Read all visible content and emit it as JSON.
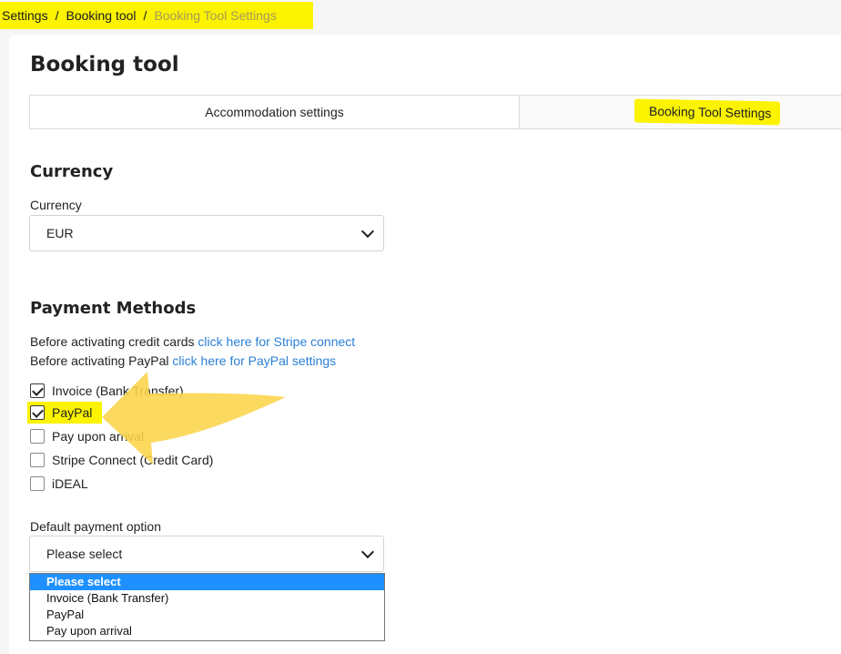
{
  "breadcrumb": {
    "items": [
      "Settings",
      "Booking tool",
      "Booking Tool Settings"
    ],
    "separator": "/"
  },
  "page": {
    "title": "Booking tool"
  },
  "tabs": [
    {
      "label": "Accommodation settings"
    },
    {
      "label": "Booking Tool Settings"
    }
  ],
  "currency": {
    "section_title": "Currency",
    "label": "Currency",
    "value": "EUR"
  },
  "payment": {
    "section_title": "Payment Methods",
    "info1": {
      "text": "Before activating credit cards ",
      "link": "click here for Stripe connect"
    },
    "info2": {
      "text": "Before activating PayPal ",
      "link": "click here for PayPal settings"
    },
    "methods": [
      {
        "label": "Invoice (Bank Transfer)",
        "checked": true
      },
      {
        "label": "PayPal",
        "checked": true
      },
      {
        "label": "Pay upon arrival",
        "checked": false
      },
      {
        "label": "Stripe Connect (Credit Card)",
        "checked": false
      },
      {
        "label": "iDEAL",
        "checked": false
      }
    ]
  },
  "default_payment": {
    "label": "Default payment option",
    "value": "Please select",
    "options": [
      "Please select",
      "Invoice (Bank Transfer)",
      "PayPal",
      "Pay upon arrival"
    ]
  },
  "colors": {
    "highlight": "#fbf300",
    "link": "#2b7fd6",
    "arrow": "#fcd54a",
    "selected_option": "#1e90ff"
  }
}
